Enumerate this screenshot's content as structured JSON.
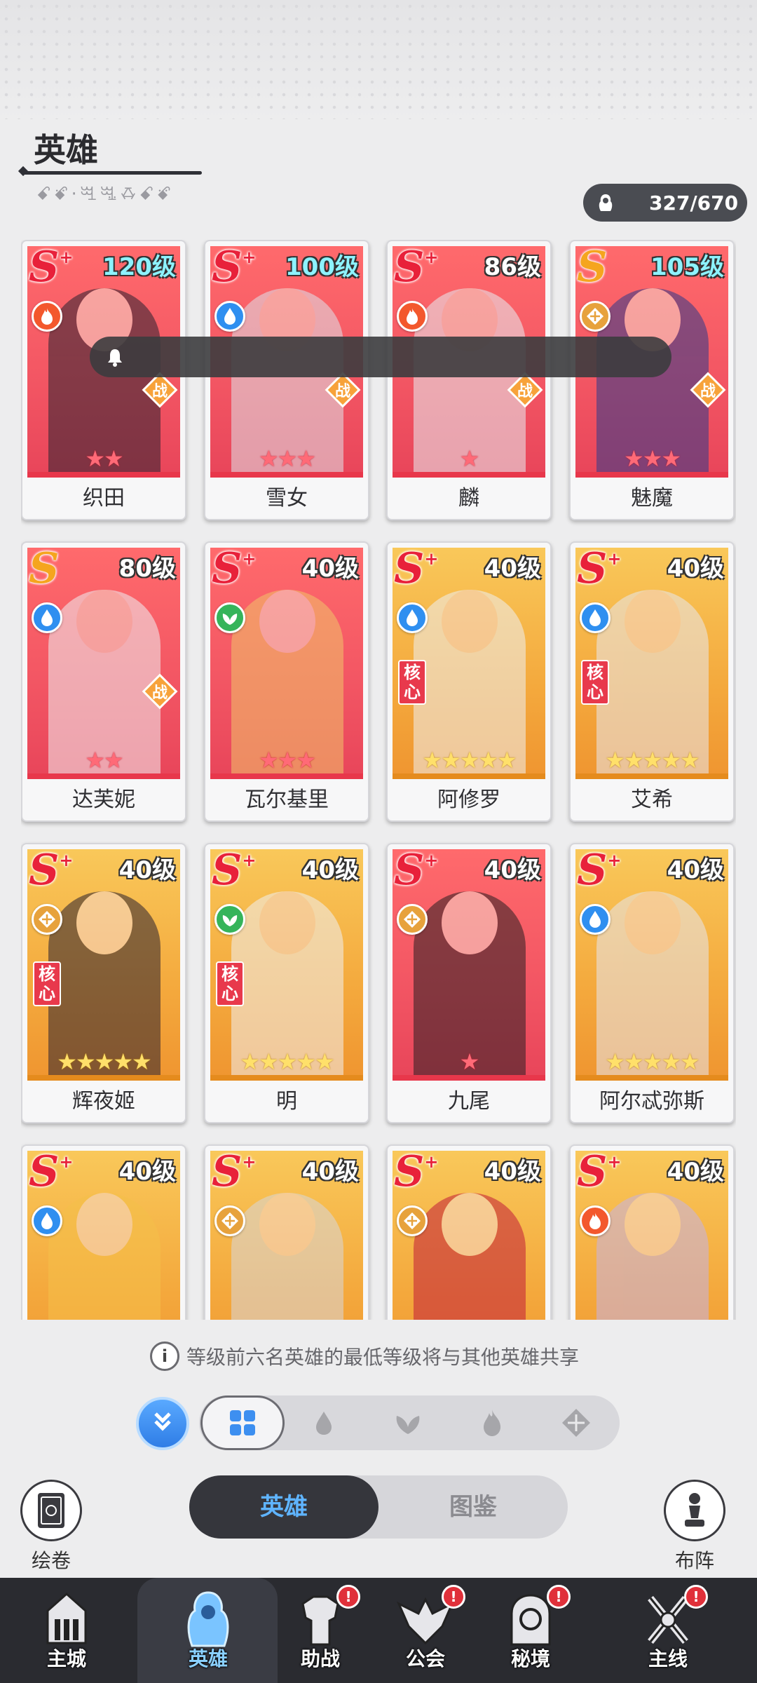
{
  "header": {
    "title": "英雄",
    "subtitle": "ꗃꗄ·ꗅꗆꗇꗃꗄ",
    "hero_count": "327/670"
  },
  "colors": {
    "red_card": "#f25563",
    "gold_card": "#f4a93d",
    "accent_blue": "#5fb4ff",
    "badge_red": "#e0303a",
    "dark": "#35363c"
  },
  "heroes": [
    {
      "name": "织田",
      "rank": "S",
      "plus": "+",
      "level": "120级",
      "element": "fire-icon",
      "role": "战",
      "stars": "★★",
      "bg": "red"
    },
    {
      "name": "雪女",
      "rank": "S",
      "plus": "+",
      "level": "100级",
      "element": "water-icon",
      "role": "战",
      "stars": "★★★",
      "bg": "red"
    },
    {
      "name": "麟",
      "rank": "S",
      "plus": "+",
      "level": "86级",
      "element": "fire-icon",
      "role": "战",
      "stars": "★",
      "bg": "red"
    },
    {
      "name": "魅魔",
      "rank": "S",
      "plus": "",
      "level": "105级",
      "element": "light-icon",
      "role": "战",
      "stars": "★★★",
      "bg": "red"
    },
    {
      "name": "达芙妮",
      "rank": "S",
      "plus": "",
      "level": "80级",
      "element": "water-icon",
      "role": "战",
      "stars": "★★",
      "bg": "red"
    },
    {
      "name": "瓦尔基里",
      "rank": "S",
      "plus": "+",
      "level": "40级",
      "element": "wind-icon",
      "role": "",
      "stars": "★★★",
      "bg": "red"
    },
    {
      "name": "阿修罗",
      "rank": "S",
      "plus": "+",
      "level": "40级",
      "element": "water-icon",
      "role": "核心",
      "stars": "★★★★★",
      "bg": "gold"
    },
    {
      "name": "艾希",
      "rank": "S",
      "plus": "+",
      "level": "40级",
      "element": "water-icon",
      "role": "核心",
      "stars": "★★★★★",
      "bg": "gold"
    },
    {
      "name": "辉夜姬",
      "rank": "S",
      "plus": "+",
      "level": "40级",
      "element": "light-icon",
      "role": "核心",
      "stars": "★★★★★",
      "bg": "gold"
    },
    {
      "name": "明",
      "rank": "S",
      "plus": "+",
      "level": "40级",
      "element": "wind-icon",
      "role": "核心",
      "stars": "★★★★★",
      "bg": "gold"
    },
    {
      "name": "九尾",
      "rank": "S",
      "plus": "+",
      "level": "40级",
      "element": "light-icon",
      "role": "",
      "stars": "★",
      "bg": "red"
    },
    {
      "name": "阿尔忒弥斯",
      "rank": "S",
      "plus": "+",
      "level": "40级",
      "element": "water-icon",
      "role": "",
      "stars": "★★★★★",
      "bg": "gold"
    },
    {
      "name": "",
      "rank": "S",
      "plus": "+",
      "level": "40级",
      "element": "water-icon",
      "role": "",
      "stars": "",
      "bg": "gold"
    },
    {
      "name": "",
      "rank": "S",
      "plus": "+",
      "level": "40级",
      "element": "light-icon",
      "role": "",
      "stars": "",
      "bg": "gold"
    },
    {
      "name": "",
      "rank": "S",
      "plus": "+",
      "level": "40级",
      "element": "light-icon",
      "role": "",
      "stars": "",
      "bg": "gold"
    },
    {
      "name": "",
      "rank": "S",
      "plus": "+",
      "level": "40级",
      "element": "fire-icon",
      "role": "",
      "stars": "",
      "bg": "gold"
    }
  ],
  "info_text": "等级前六名英雄的最低等级将与其他英雄共享",
  "filter": {
    "options": [
      "all-grid-icon",
      "water-drop-icon",
      "leaf-icon",
      "flame-icon",
      "light-diamond-icon"
    ],
    "selected": "all-grid-icon"
  },
  "tabs": {
    "heroes": "英雄",
    "codex": "图鉴"
  },
  "side": {
    "scroll_label": "绘卷",
    "formation_label": "布阵"
  },
  "nav": [
    {
      "label": "主城",
      "icon": "castle-icon",
      "badge": ""
    },
    {
      "label": "英雄",
      "icon": "hero-icon",
      "badge": ""
    },
    {
      "label": "助战",
      "icon": "armor-icon",
      "badge": "!"
    },
    {
      "label": "公会",
      "icon": "guild-wings-icon",
      "badge": "!"
    },
    {
      "label": "秘境",
      "icon": "portal-icon",
      "badge": "!"
    },
    {
      "label": "主线",
      "icon": "swords-icon",
      "badge": "!"
    }
  ]
}
